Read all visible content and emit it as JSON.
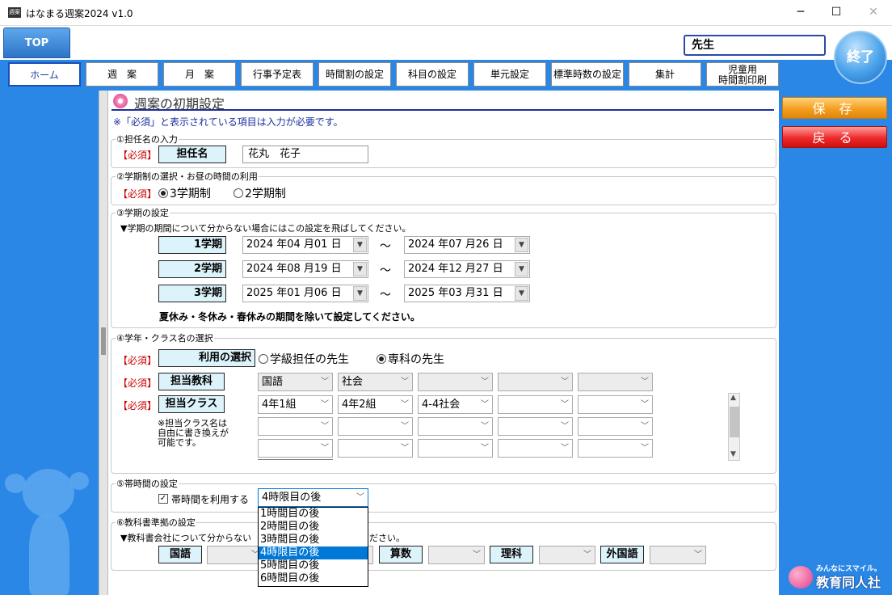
{
  "app": {
    "title": "はなまる週案2024 v1.0",
    "icon_text": "週案"
  },
  "window": {
    "minimize": "─",
    "maximize": "☐",
    "close": "✕"
  },
  "top": {
    "top_tab": "TOP",
    "user": "先生",
    "exit": "終了"
  },
  "nav": [
    "ホーム",
    "週　案",
    "月　案",
    "行事予定表",
    "時間割の設定",
    "科目の設定",
    "単元設定",
    "標準時数の設定",
    "集計"
  ],
  "nav_print": {
    "line1": "児童用",
    "line2": "時間割印刷"
  },
  "actions": {
    "save": "保 存",
    "back": "戻 る"
  },
  "brand": {
    "tagline": "みんなにスマイル。",
    "name": "教育同人社"
  },
  "page": {
    "heading": "週案の初期設定",
    "note": "※「必須」と表示されている項目は入力が必要です。",
    "required": "【必須】"
  },
  "s1": {
    "title": "①担任名の入力",
    "label": "担任名",
    "value": "花丸　花子"
  },
  "s2": {
    "title": "②学期制の選択・お昼の時間の利用",
    "opt1": "3学期制",
    "opt2": "2学期制",
    "selected": "3学期制"
  },
  "s3": {
    "title": "③学期の設定",
    "hint": "▼学期の期間について分からない場合にはこの設定を飛ばしてください。",
    "tilde": "～",
    "terms": [
      {
        "label": "1学期",
        "start": "2024 年04 月01 日",
        "end": "2024 年07 月26 日"
      },
      {
        "label": "2学期",
        "start": "2024 年08 月19 日",
        "end": "2024 年12 月27 日"
      },
      {
        "label": "3学期",
        "start": "2025 年01 月06 日",
        "end": "2025 年03 月31 日"
      }
    ],
    "footnote": "夏休み・冬休み・春休みの期間を除いて設定してください。"
  },
  "s4": {
    "title": "④学年・クラス名の選択",
    "use_label": "利用の選択",
    "opt1": "学級担任の先生",
    "opt2": "専科の先生",
    "selected": "専科の先生",
    "subject_label": "担当教科",
    "class_label": "担当クラス",
    "subjects": [
      "国語",
      "社会",
      "",
      "",
      ""
    ],
    "classes": [
      "4年1組",
      "4年2組",
      "4-4社会",
      "",
      ""
    ],
    "note_line1": "※担当クラス名は",
    "note_line2": "自由に書き換えが",
    "note_line3": "可能です。"
  },
  "s5": {
    "title": "⑤帯時間の設定",
    "check_label": "帯時間を利用する",
    "checked": true,
    "selected": "4時限目の後"
  },
  "dropdown": {
    "options": [
      "1時間目の後",
      "2時間目の後",
      "3時間目の後",
      "4時限目の後",
      "5時間目の後",
      "6時間目の後"
    ],
    "selected_index": 3
  },
  "s6": {
    "title": "⑥教科書準拠の設定",
    "hint_left": "▼教科書会社について分からない",
    "hint_right": "ださい。",
    "subjects": [
      "国語",
      "算数",
      "理科",
      "外国語"
    ]
  },
  "colors": {
    "nav_blue": "#2a87e6",
    "required_red": "#cc0000",
    "label_bg": "#ddf3fb",
    "save_orange": "#f59e1e",
    "back_red": "#ee2a2a",
    "heading_line": "#1a2f9f"
  }
}
